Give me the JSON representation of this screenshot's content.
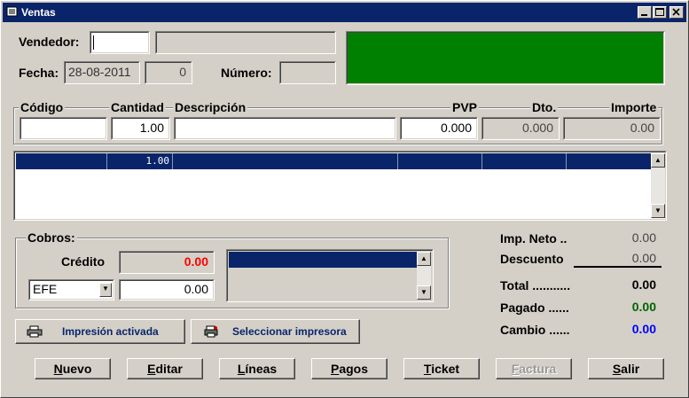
{
  "window": {
    "title": "Ventas"
  },
  "header": {
    "vendedor_label": "Vendedor:",
    "vendedor_code": "",
    "vendedor_name": "",
    "fecha_label": "Fecha:",
    "fecha_value": "28-08-2011",
    "fecha_extra": "0",
    "numero_label": "Número:",
    "numero_value": "",
    "display_color": "#008000"
  },
  "line_entry": {
    "headers": {
      "codigo": "Código",
      "cantidad": "Cantidad",
      "descripcion": "Descripción",
      "pvp": "PVP",
      "dto": "Dto.",
      "importe": "Importe"
    },
    "codigo": "",
    "cantidad": "1.00",
    "descripcion": "",
    "pvp": "0.000",
    "dto": "0.000",
    "importe": "0.00"
  },
  "lines_grid": {
    "rows": [
      {
        "codigo": "",
        "cantidad": "1.00",
        "descripcion": "",
        "pvp": "",
        "dto": "",
        "importe": ""
      }
    ]
  },
  "cobros": {
    "title": "Cobros:",
    "credito_label": "Crédito",
    "credito_value": "0.00",
    "payment_method": "EFE",
    "payment_amount": "0.00"
  },
  "totals": {
    "imp_neto_label": "Imp. Neto ..",
    "imp_neto_value": "0.00",
    "descuento_label": "Descuento",
    "descuento_value": "0.00",
    "total_label": "Total ...........",
    "total_value": "0.00",
    "pagado_label": "Pagado ......",
    "pagado_value": "0.00",
    "cambio_label": "Cambio ......",
    "cambio_value": "0.00",
    "colors": {
      "credito": "#ff0000",
      "pagado": "#006400",
      "cambio": "#0000ff"
    }
  },
  "printer": {
    "impresion_label": "Impresión activada",
    "seleccionar_label": "Seleccionar impresora"
  },
  "actions": {
    "nuevo_a": "N",
    "nuevo_b": "uevo",
    "editar_a": "E",
    "editar_b": "ditar",
    "lineas_a": "L",
    "lineas_b": "íneas",
    "pagos_a": "P",
    "pagos_b": "agos",
    "ticket_a": "T",
    "ticket_b": "icket",
    "factura_a": "F",
    "factura_b": "actura",
    "salir_a": "S",
    "salir_b": "alir"
  }
}
